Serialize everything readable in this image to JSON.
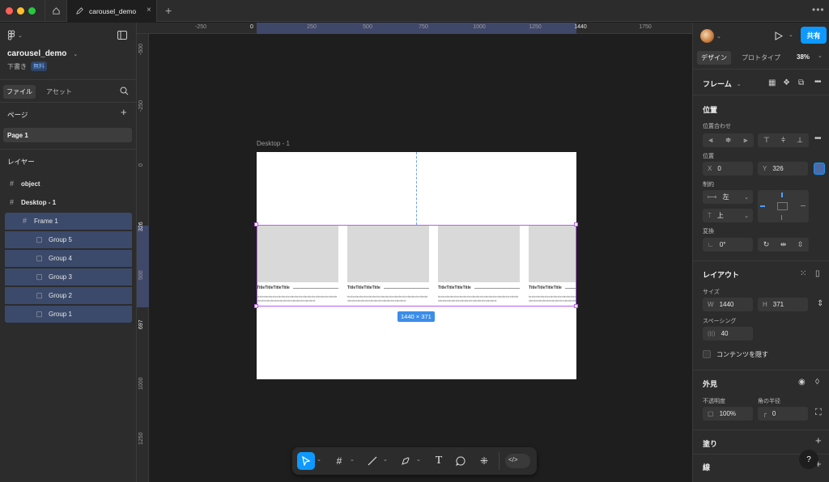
{
  "titlebar": {
    "tab_title": "carousel_demo"
  },
  "left_panel": {
    "file_name": "carousel_demo",
    "draft_label": "下書き",
    "plan_badge": "無料",
    "tabs": [
      "ファイル",
      "アセット"
    ],
    "pages_header": "ページ",
    "pages": [
      "Page 1"
    ],
    "layers_header": "レイヤー",
    "layers": [
      {
        "name": "object",
        "bold": true,
        "selected": false
      },
      {
        "name": "Desktop - 1",
        "bold": true,
        "selected": false
      },
      {
        "name": "Frame 1",
        "bold": false,
        "selected": true
      },
      {
        "name": "Group 5",
        "bold": false,
        "selected": true
      },
      {
        "name": "Group 4",
        "bold": false,
        "selected": true
      },
      {
        "name": "Group 3",
        "bold": false,
        "selected": true
      },
      {
        "name": "Group 2",
        "bold": false,
        "selected": true
      },
      {
        "name": "Group 1",
        "bold": false,
        "selected": true
      }
    ]
  },
  "rulers": {
    "top": [
      "-250",
      "0",
      "250",
      "500",
      "750",
      "1000",
      "1250",
      "1440",
      "1750"
    ],
    "left": [
      "-500",
      "-250",
      "0",
      "326",
      "500",
      "697",
      "1000",
      "1250"
    ]
  },
  "canvas": {
    "frame_label": "Desktop - 1",
    "dimension_badge": "1440 × 371",
    "card_title": "TitleTitleTitleTitle",
    "card_text": "textextextextextextextextextextextextextextextextextextextextextextextextextextextextextextextext"
  },
  "right_panel": {
    "share_label": "共有",
    "tabs": [
      "デザイン",
      "プロトタイプ"
    ],
    "zoom": "38%",
    "frame_type": "フレーム",
    "position_header": "位置",
    "alignment_label": "位置合わせ",
    "position_label": "位置",
    "x_prefix": "X",
    "x_value": "0",
    "y_prefix": "Y",
    "y_value": "326",
    "constraints_label": "制約",
    "constraint_h": "左",
    "constraint_v": "上",
    "transform_label": "変換",
    "rotation": "0°",
    "layout_header": "レイアウト",
    "size_label": "サイズ",
    "w_prefix": "W",
    "w_value": "1440",
    "h_prefix": "H",
    "h_value": "371",
    "spacing_label": "スペーシング",
    "spacing_value": "40",
    "clip_label": "コンテンツを隠す",
    "appearance_header": "外見",
    "opacity_label": "不透明度",
    "opacity_value": "100%",
    "radius_label": "角の半径",
    "radius_value": "0",
    "fill_header": "塗り",
    "stroke_header": "線",
    "help": "?"
  },
  "colors": {
    "accent": "#0d99ff",
    "selection": "#b95fe8",
    "layer_selected": "#3b4a6b"
  }
}
